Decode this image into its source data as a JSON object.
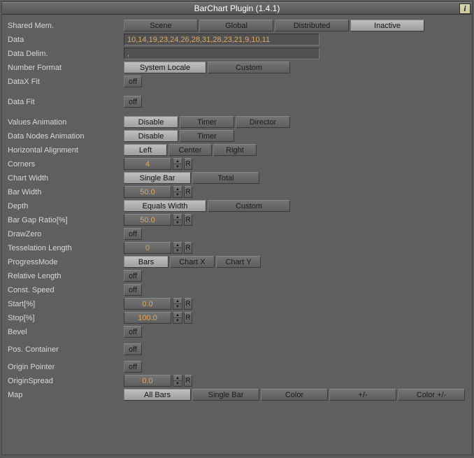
{
  "title": "BarChart Plugin (1.4.1)",
  "info": "i",
  "labels": {
    "sharedMem": "Shared Mem.",
    "data": "Data",
    "dataDelim": "Data Delim.",
    "numberFormat": "Number Format",
    "dataXFit": "DataX Fit",
    "dataFit": "Data Fit",
    "valuesAnim": "Values Animation",
    "nodesAnim": "Data Nodes Animation",
    "hAlign": "Horizontal Alignment",
    "corners": "Corners",
    "chartWidth": "Chart Width",
    "barWidth": "Bar Width",
    "depth": "Depth",
    "barGap": "Bar Gap Ratio[%]",
    "drawZero": "DrawZero",
    "tess": "Tesselation Length",
    "progress": "ProgressMode",
    "relLen": "Relative Length",
    "constSpd": "Const. Speed",
    "start": "Start[%]",
    "stop": "Stop[%]",
    "bevel": "Bevel",
    "posContainer": "Pos. Container",
    "originPtr": "Origin Pointer",
    "originSpread": "OriginSpread",
    "map": "Map"
  },
  "sharedMemTabs": [
    "Scene",
    "Global",
    "Distributed",
    "Inactive"
  ],
  "dataValue": "10,14,19,23,24,26,28,31,28,23,21,9,10,11",
  "dataDelimValue": ",",
  "numberFormatTabs": [
    "System Locale",
    "Custom"
  ],
  "off": "off",
  "valuesAnimTabs": [
    "Disable",
    "Timer",
    "Director"
  ],
  "nodesAnimTabs": [
    "Disable",
    "Timer"
  ],
  "hAlignTabs": [
    "Left",
    "Center",
    "Right"
  ],
  "cornersVal": "4",
  "chartWidthTabs": [
    "Single Bar",
    "Total"
  ],
  "barWidthVal": "50.0",
  "depthTabs": [
    "Equals Width",
    "Custom"
  ],
  "barGapVal": "50.0",
  "tessVal": "0",
  "progressTabs": [
    "Bars",
    "Chart X",
    "Chart Y"
  ],
  "startVal": "0.0",
  "stopVal": "100.0",
  "originSpreadVal": "0.0",
  "mapTabs": [
    "All Bars",
    "Single Bar",
    "Color",
    "+/-",
    "Color +/-"
  ],
  "reset": "R"
}
